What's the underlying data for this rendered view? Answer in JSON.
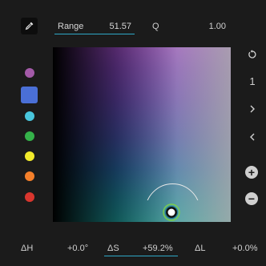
{
  "toolbar": {
    "eyedropper_icon": "eyedropper-icon",
    "range_label": "Range",
    "range_value": "51.57",
    "q_label": "Q",
    "q_value": "1.00"
  },
  "swatches": [
    {
      "name": "purple",
      "color": "#a35aa8"
    },
    {
      "name": "blue",
      "color": "#4a6fd6",
      "selected": true
    },
    {
      "name": "cyan",
      "color": "#49c6dd"
    },
    {
      "name": "green",
      "color": "#35b24a"
    },
    {
      "name": "yellow",
      "color": "#f2ea2b"
    },
    {
      "name": "orange",
      "color": "#f47f2a"
    },
    {
      "name": "red",
      "color": "#d9362e"
    }
  ],
  "right_controls": {
    "reset_icon": "reset-icon",
    "page_number": "1",
    "next_icon": "chevron-right-icon",
    "prev_icon": "chevron-left-icon",
    "add_icon": "plus-icon",
    "remove_icon": "minus-icon"
  },
  "adjustments": {
    "dh_label": "ΔH",
    "dh_value": "+0.0°",
    "ds_label": "ΔS",
    "ds_value": "+59.2%",
    "dl_label": "ΔL",
    "dl_value": "+0.0%"
  },
  "colors": {
    "accent": "#2ea8c7",
    "background": "#1b1b1b",
    "picker_ring": "#e8e8e8",
    "handle_outline": "#7ad04b"
  }
}
